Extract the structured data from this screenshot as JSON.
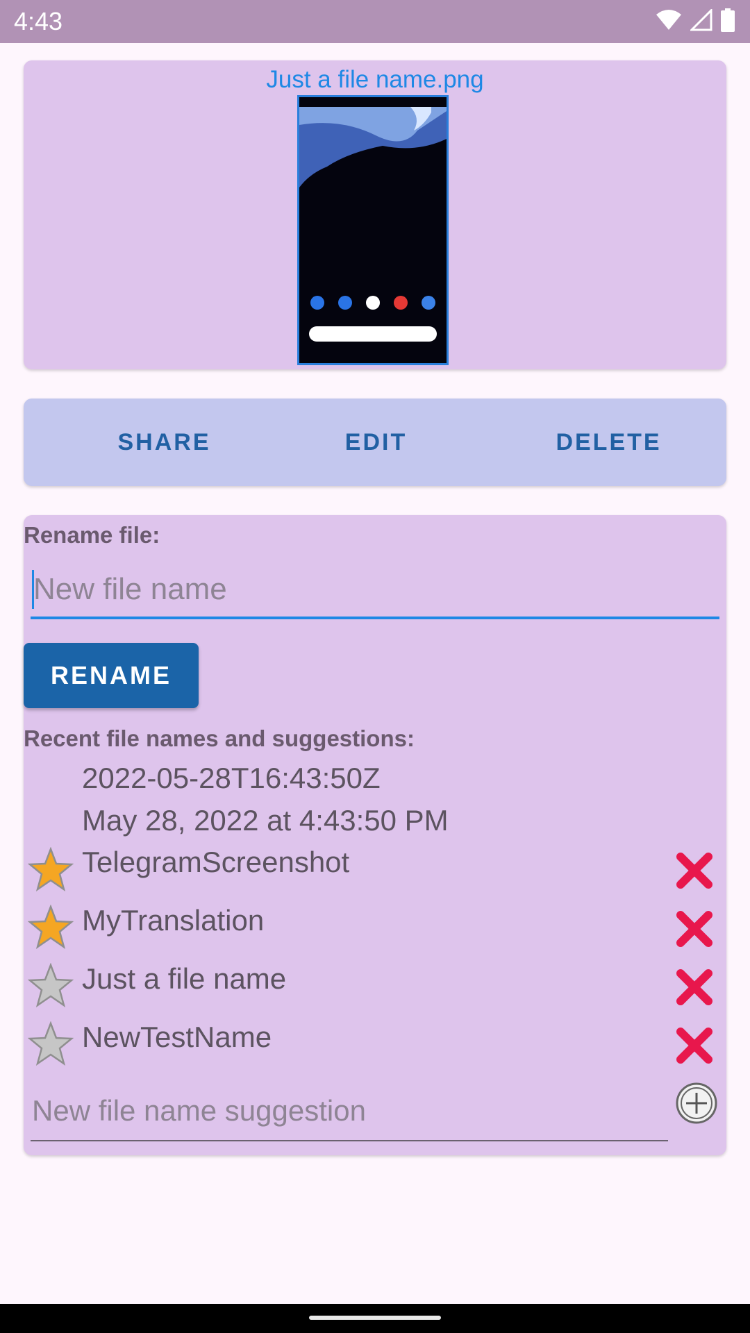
{
  "status_bar": {
    "time": "4:43"
  },
  "preview": {
    "file_name": "Just a file name.png"
  },
  "actions": {
    "share": "SHARE",
    "edit": "EDIT",
    "delete": "DELETE"
  },
  "rename": {
    "label": "Rename file:",
    "input_placeholder": "New file name",
    "button": "RENAME"
  },
  "suggestions": {
    "label": "Recent file names and suggestions:",
    "plain_items": [
      "2022-05-28T16:43:50Z",
      "May 28, 2022 at 4:43:50 PM"
    ],
    "items": [
      {
        "name": "TelegramScreenshot",
        "starred": true
      },
      {
        "name": "MyTranslation",
        "starred": true
      },
      {
        "name": "Just a file name",
        "starred": false
      },
      {
        "name": "NewTestName",
        "starred": false
      }
    ],
    "new_placeholder": "New file name suggestion"
  },
  "colors": {
    "accent": "#1e88e5",
    "star_on": "#f5a623",
    "star_off": "#bdbdbd",
    "delete_x": "#e8174c"
  }
}
